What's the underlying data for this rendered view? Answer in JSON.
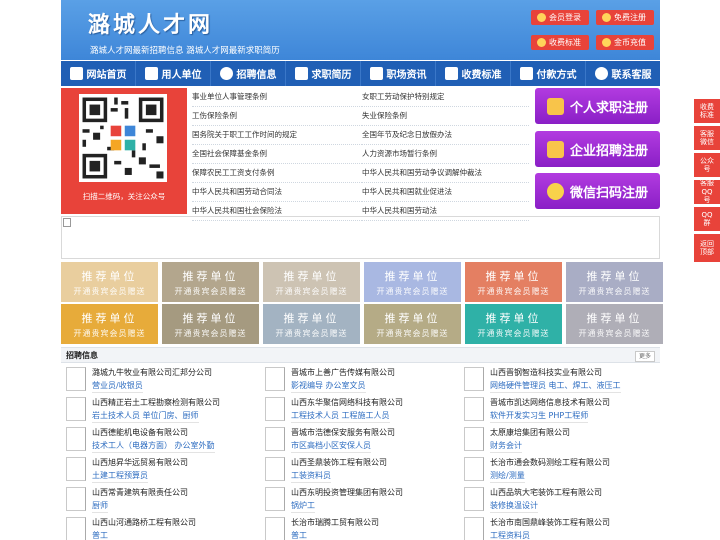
{
  "header": {
    "logo": "潞城人才网",
    "slogan": "潞城人才网最新招聘信息  潞城人才网最新求职简历",
    "buttons": [
      {
        "label": "会员登录",
        "icon": "user-icon"
      },
      {
        "label": "免费注册",
        "icon": "register-icon"
      },
      {
        "label": "收费标准",
        "icon": "price-icon"
      },
      {
        "label": "金币充值",
        "icon": "coin-icon"
      }
    ]
  },
  "nav": [
    {
      "label": "网站首页",
      "icon": "home-icon"
    },
    {
      "label": "用人单位",
      "icon": "building-icon"
    },
    {
      "label": "招聘信息",
      "icon": "megaphone-icon"
    },
    {
      "label": "求职简历",
      "icon": "resume-icon"
    },
    {
      "label": "职场资讯",
      "icon": "news-icon"
    },
    {
      "label": "收费标准",
      "icon": "price-tag-icon"
    },
    {
      "label": "付款方式",
      "icon": "payment-icon"
    },
    {
      "label": "联系客服",
      "icon": "phone-icon"
    }
  ],
  "qr": {
    "caption": "扫描二维码，关注公众号"
  },
  "regulations": [
    [
      "事业单位人事管理条例",
      "女职工劳动保护特别规定"
    ],
    [
      "工伤保险条例",
      "失业保险条例"
    ],
    [
      "国务院关于职工工作时间的规定",
      "全国年节及纪念日放假办法"
    ],
    [
      "全国社会保障基金条例",
      "人力资源市场暂行条例"
    ],
    [
      "保障农民工工资支付条例",
      "中华人民共和国劳动争议调解仲裁法"
    ],
    [
      "中华人民共和国劳动合同法",
      "中华人民共和国就业促进法"
    ],
    [
      "中华人民共和国社会保险法",
      "中华人民共和国劳动法"
    ]
  ],
  "register_buttons": [
    {
      "label": "个人求职注册",
      "icon": "person-icon"
    },
    {
      "label": "企业招聘注册",
      "icon": "company-icon"
    },
    {
      "label": "微信扫码注册",
      "icon": "wechat-icon"
    }
  ],
  "side_float": [
    "收费标准",
    "客服微信",
    "公众号",
    "客服QQ号",
    "QQ群",
    "返回顶部"
  ],
  "tiles": {
    "title": "推荐单位",
    "subtitle": "开通贵宾会员赠送",
    "colors": [
      "#e9ce9e",
      "#b3a68d",
      "#cdc3b3",
      "#a9b8e2",
      "#e47f62",
      "#a9adc5",
      "#e7ab3a",
      "#a59a80",
      "#a3b3c2",
      "#b5ab86",
      "#2fb1a7",
      "#afaeb7"
    ]
  },
  "jobs": {
    "title": "招聘信息",
    "more": "更多",
    "items": [
      {
        "company": "潞城九牛牧业有限公司汇邦分公司",
        "position": "营业员/收银员"
      },
      {
        "company": "晋城市上善广告传媒有限公司",
        "position": "影视编导 办公室文员"
      },
      {
        "company": "山西晋钢智造科技实业有限公司",
        "position": "网络硬件管理员 电工、焊工、液压工"
      },
      {
        "company": "山西精正岩土工程勘察检测有限公司",
        "position": "岩土技术人员 单位门房、厨师"
      },
      {
        "company": "山西东华聚信网络科技有限公司",
        "position": "工程技术人员 工程施工人员"
      },
      {
        "company": "晋城市凯达网络信息技术有限公司",
        "position": "软件开发实习生 PHP工程师"
      },
      {
        "company": "山西德能机电设备有限公司",
        "position": "技术工人（电器方面） 办公室外勤"
      },
      {
        "company": "晋城市浩德保安服务有限公司",
        "position": "市区高档小区安保人员"
      },
      {
        "company": "太原康培集团有限公司",
        "position": "财务会计"
      },
      {
        "company": "山西旭昇华远贸易有限公司",
        "position": "土建工程预算员"
      },
      {
        "company": "山西圣鼎装饰工程有限公司",
        "position": "工装资料员"
      },
      {
        "company": "长治市通会数码测绘工程有限公司",
        "position": "测绘/测量"
      },
      {
        "company": "山西常青建筑有限责任公司",
        "position": "厨师"
      },
      {
        "company": "山西东明投资管理集团有限公司",
        "position": "锅炉工"
      },
      {
        "company": "山西品筑大宅装饰工程有限公司",
        "position": "装修换温设计"
      },
      {
        "company": "山西山河通路桥工程有限公司",
        "position": "普工"
      },
      {
        "company": "长治市瑞腾工贸有限公司",
        "position": "普工"
      },
      {
        "company": "长治市南国鼎峰装饰工程有限公司",
        "position": "工程资料员"
      }
    ]
  }
}
